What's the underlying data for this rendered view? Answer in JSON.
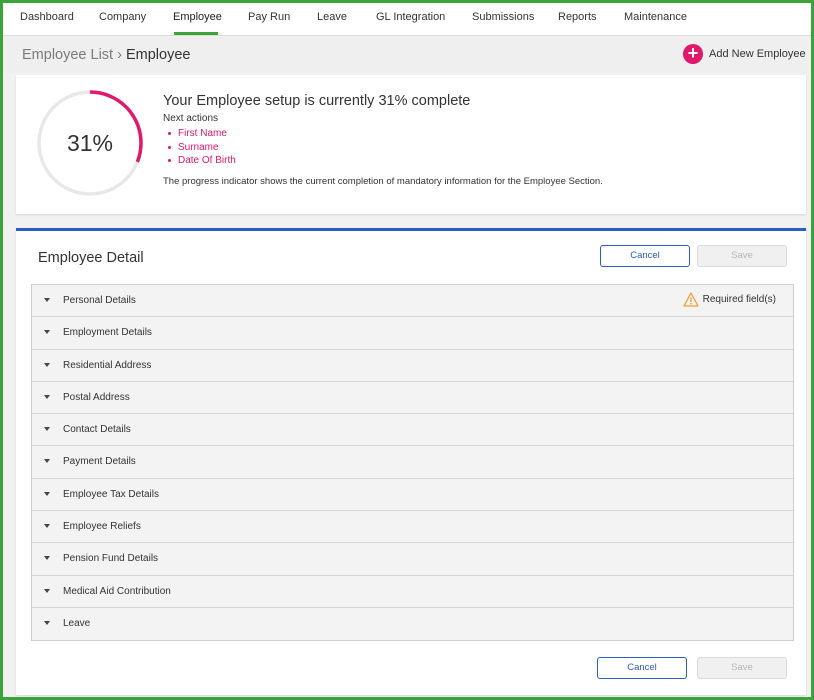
{
  "nav": {
    "items": [
      {
        "label": "Dashboard",
        "left": 0
      },
      {
        "label": "Company"
      },
      {
        "label": "Employee"
      },
      {
        "label": "Pay Run"
      },
      {
        "label": "Leave"
      },
      {
        "label": "GL Integration"
      },
      {
        "label": "Submissions"
      },
      {
        "label": "Reports"
      },
      {
        "label": "Maintenance"
      }
    ],
    "active": "Employee"
  },
  "breadcrumb": {
    "parent": "Employee List",
    "separator": "›",
    "current": "Employee"
  },
  "add_employee": {
    "icon": "plus-icon",
    "label": "Add New Employee"
  },
  "progress": {
    "percent_text": "31%",
    "percent_value": 31,
    "title": "Your Employee setup is currently 31% complete",
    "next_actions_label": "Next actions",
    "actions": [
      "First Name",
      "Surname",
      "Date Of Birth"
    ],
    "description": "The progress indicator shows the current completion of mandatory information for the Employee Section."
  },
  "detail": {
    "title": "Employee Detail",
    "cancel_label": "Cancel",
    "save_label": "Save",
    "required_label": "Required field(s)",
    "sections": [
      "Personal Details",
      "Employment Details",
      "Residential Address",
      "Postal Address",
      "Contact Details",
      "Payment Details",
      "Employee Tax Details",
      "Employee Reliefs",
      "Pension Fund Details",
      "Medical Aid Contribution",
      "Leave"
    ]
  },
  "colors": {
    "accent_pink": "#e0196b",
    "accent_blue": "#2a5fbf",
    "accent_green": "#3aa43a",
    "warning_orange": "#f0a030"
  }
}
